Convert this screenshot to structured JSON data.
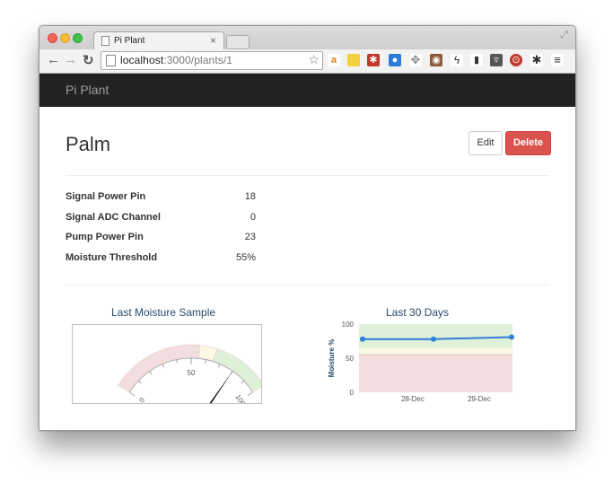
{
  "browser": {
    "tab_title": "Pi Plant",
    "url_host": "localhost",
    "url_path": ":3000/plants/1"
  },
  "navbar": {
    "brand": "Pi Plant"
  },
  "plant": {
    "name": "Palm",
    "edit_label": "Edit",
    "delete_label": "Delete",
    "fields": [
      {
        "label": "Signal Power Pin",
        "value": "18"
      },
      {
        "label": "Signal ADC Channel",
        "value": "0"
      },
      {
        "label": "Pump Power Pin",
        "value": "23"
      },
      {
        "label": "Moisture Threshold",
        "value": "55%"
      }
    ]
  },
  "gauge": {
    "title": "Last Moisture Sample",
    "min_label": "0",
    "mid_label": "50",
    "max_label": "100",
    "value": 80,
    "bands": [
      {
        "from": 0,
        "to": 55,
        "color": "#f2dede"
      },
      {
        "from": 55,
        "to": 65,
        "color": "#fcf8e3"
      },
      {
        "from": 65,
        "to": 100,
        "color": "#dff0d8"
      }
    ]
  },
  "chart_data": {
    "type": "line",
    "title": "Last 30 Days",
    "ylabel": "Moisture %",
    "yticks": [
      "100",
      "50",
      "0"
    ],
    "ylim": [
      0,
      100
    ],
    "xticks": [
      "28-Dec",
      "29-Dec"
    ],
    "bands": [
      {
        "from": 0,
        "to": 55,
        "color": "#f2dede"
      },
      {
        "from": 55,
        "to": 65,
        "color": "#fcf8e3"
      },
      {
        "from": 65,
        "to": 100,
        "color": "#dff0d8"
      }
    ],
    "series": [
      {
        "values": [
          78,
          78,
          81
        ],
        "color": "#2f7ed8"
      }
    ]
  }
}
